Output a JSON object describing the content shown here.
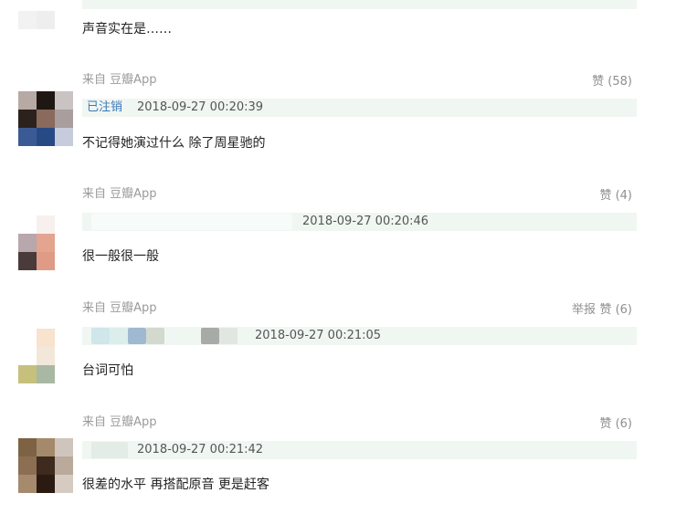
{
  "comments": [
    {
      "content": "声音实在是……"
    },
    {
      "from": "来自 豆瓣App",
      "vote": "赞 (58)",
      "user": "已注销",
      "time": "2018-09-27 00:20:39",
      "content": "不记得她演过什么 除了周星驰的"
    },
    {
      "from": "来自 豆瓣App",
      "vote": "赞 (4)",
      "time": "2018-09-27 00:20:46",
      "content": "很一般很一般"
    },
    {
      "from": "来自 豆瓣App",
      "report": "举报",
      "vote": "赞 (6)",
      "time": "2018-09-27 00:21:05",
      "content": "台词可怕"
    },
    {
      "from": "来自 豆瓣App",
      "vote": "赞 (6)",
      "time": "2018-09-27 00:21:42",
      "content": "很差的水平 再搭配原音 更是赶客"
    }
  ],
  "colors": {
    "meta_bar": "#f0f6f2",
    "username": "#3a78b8",
    "muted": "#9a9a9a",
    "text": "#222222"
  }
}
